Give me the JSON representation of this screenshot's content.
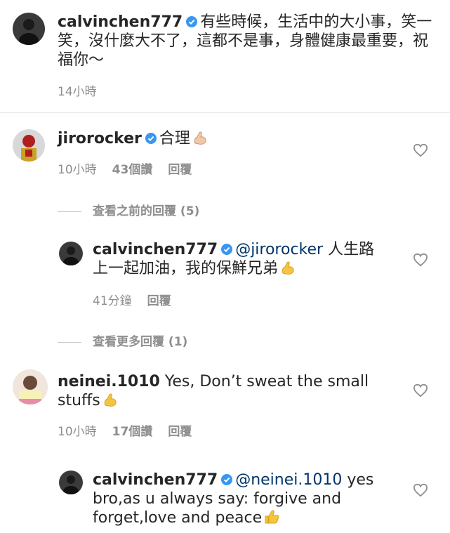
{
  "post_caption": {
    "username": "calvinchen777",
    "text": "有些時候，生活中的大小事，笑一笑，沒什麼大不了，這都不是事，身體健康最重要，祝福你～",
    "time": "14小時"
  },
  "comments": [
    {
      "username": "jirorocker",
      "text": "合理",
      "time": "10小時",
      "likes": "43個讚",
      "reply_label": "回覆",
      "view_previous_replies": "查看之前的回覆 (5)"
    },
    {
      "username": "calvinchen777",
      "mention": "@jirorocker",
      "text": "人生路上一起加油，我的保鮮兄弟",
      "time": "41分鐘",
      "reply_label": "回覆",
      "view_more_replies": "查看更多回覆 (1)"
    },
    {
      "username": "neinei.1010",
      "text": "Yes, Don’t sweat the small stuffs",
      "time": "10小時",
      "likes": "17個讚",
      "reply_label": "回覆"
    },
    {
      "username": "calvinchen777",
      "mention": "@neinei.1010",
      "text": "yes bro,as u always say: forgive and forget,love and peace"
    }
  ],
  "colors": {
    "text": "#262626",
    "meta": "#8e8e8e",
    "verified": "#3897f0",
    "mention": "#003569"
  },
  "icons": [
    "verified-badge-icon",
    "heart-icon",
    "flexed-biceps-emoji",
    "thumbs-up-emoji"
  ]
}
